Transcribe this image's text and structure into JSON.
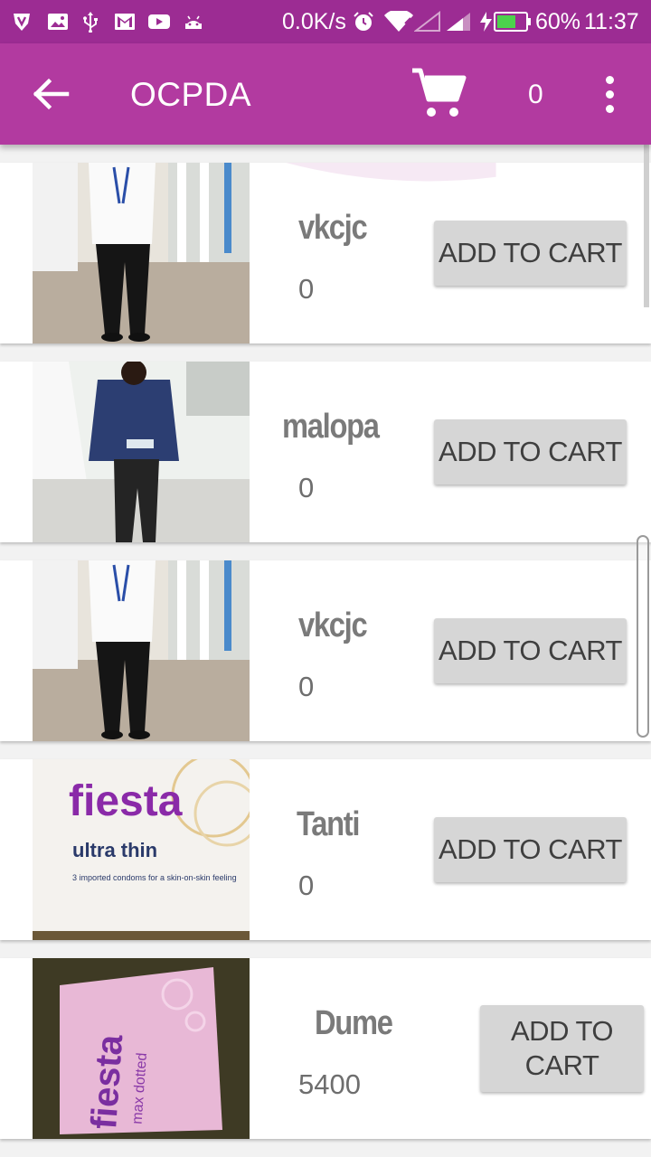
{
  "status_bar": {
    "speed": "0.0K/s",
    "battery": "60%",
    "time": "11:37"
  },
  "app_bar": {
    "title": "OCPDA",
    "cart_count": "0"
  },
  "products": [
    {
      "name": "vkcjc",
      "price": "0",
      "button": "ADD TO CART",
      "image": "man-white-shirt-photo"
    },
    {
      "name": "malopa",
      "price": "0",
      "button": "ADD TO CART",
      "image": "man-blue-shirt-photo"
    },
    {
      "name": "vkcjc",
      "price": "0",
      "button": "ADD TO CART",
      "image": "man-white-shirt-photo"
    },
    {
      "name": "Tanti",
      "price": "0",
      "button": "ADD TO CART",
      "image": "fiesta-ultra-thin-box-photo"
    },
    {
      "name": "Dume",
      "price": "5400",
      "button": "ADD TO CART",
      "image": "fiesta-max-dotted-box-photo"
    }
  ],
  "photo_text": {
    "fiesta_brand": "fiesta",
    "ultra_thin": "ultra thin",
    "ultra_thin_sub": "3 imported condoms for a skin-on-skin feeling",
    "max_dotted": "max dotted"
  },
  "colors": {
    "status_bar": "#9c2c93",
    "app_bar": "#b23aa0",
    "button_bg": "#d6d6d6"
  }
}
